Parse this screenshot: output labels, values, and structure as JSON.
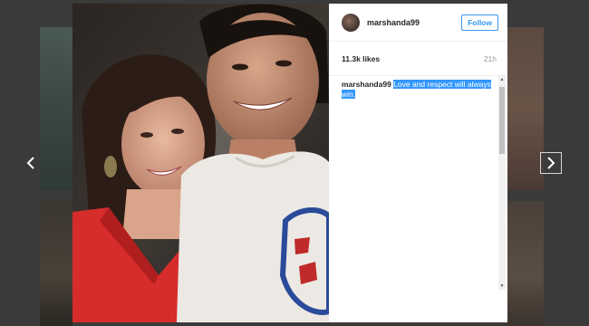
{
  "post": {
    "username": "marshanda99",
    "follow_label": "Follow",
    "likes": "11.3k likes",
    "time": "21h",
    "caption_user": "marshanda99",
    "caption_text": "Love and respect will always win."
  },
  "icons": {
    "prev": "chevron-left-icon",
    "next": "chevron-right-icon"
  },
  "colors": {
    "accent": "#3897f0",
    "selection": "#3297fd",
    "overlay": "#3a3a3a"
  }
}
